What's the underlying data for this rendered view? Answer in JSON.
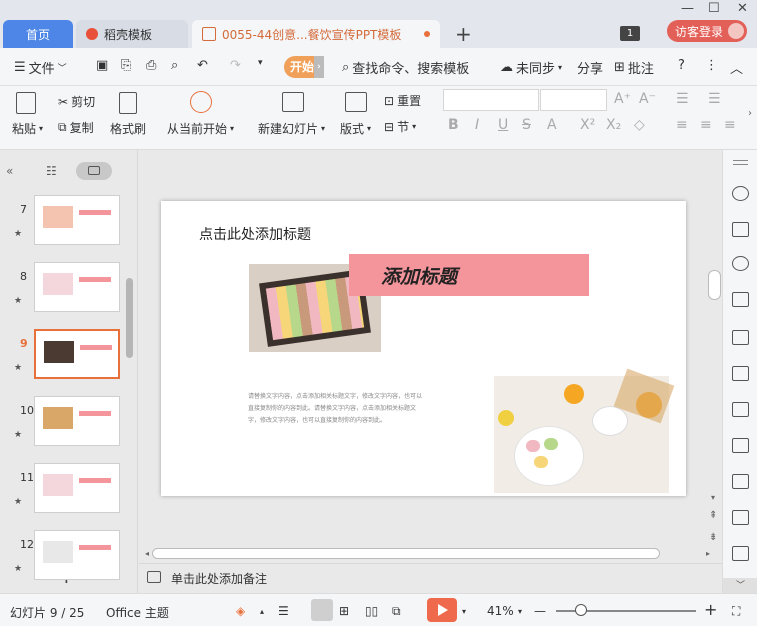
{
  "tabs": {
    "home": "首页",
    "template": "稻壳模板",
    "doc": "0055-44创意...餐饮宣传PPT模板",
    "login": "访客登录",
    "badge": "1"
  },
  "menu": {
    "file": "文件",
    "start": "开始",
    "search": "查找命令、搜索模板",
    "sync": "未同步",
    "share": "分享",
    "comment": "批注"
  },
  "ribbon": {
    "paste": "粘贴",
    "cut": "剪切",
    "copy": "复制",
    "format_painter": "格式刷",
    "from_current": "从当前开始",
    "new_slide": "新建幻灯片",
    "layout": "版式",
    "reset": "重置",
    "section": "节"
  },
  "thumbnails": [
    {
      "num": "7",
      "star": "★"
    },
    {
      "num": "8",
      "star": "★"
    },
    {
      "num": "9",
      "star": "★"
    },
    {
      "num": "10",
      "star": "★"
    },
    {
      "num": "11",
      "star": "★"
    },
    {
      "num": "12",
      "star": "★"
    }
  ],
  "slide": {
    "title_placeholder": "点击此处添加标题",
    "pink_title": "添加标题",
    "body": "请替换文字内容，点击添加相关标题文字，修改文字内容，也可以直接复制你的内容到此。请替换文字内容，点击添加相关标题文字，修改文字内容，也可以直接复制你的内容到此。"
  },
  "notes_placeholder": "单击此处添加备注",
  "status": {
    "slide_count": "幻灯片 9 / 25",
    "theme": "Office 主题",
    "zoom": "41%"
  },
  "colors": {
    "accent_orange": "#e8703a",
    "pink": "#f4959c",
    "home_tab": "#4d86e6",
    "play": "#ef6a4c"
  }
}
